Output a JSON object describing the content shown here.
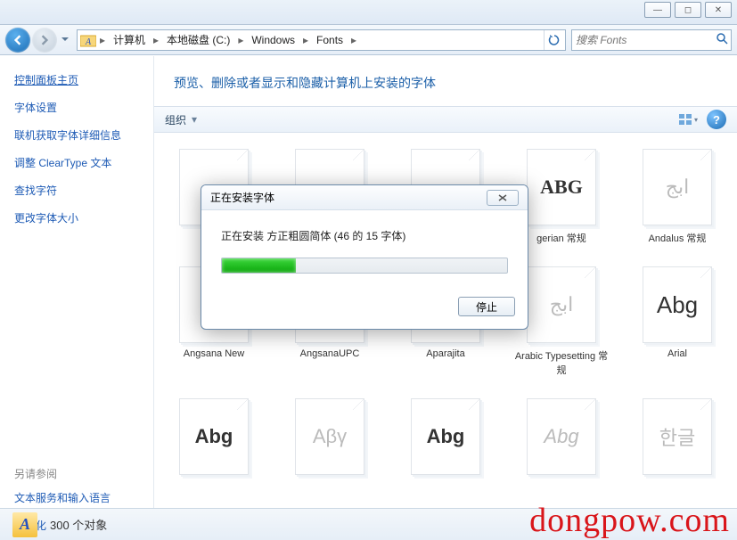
{
  "window": {
    "min": "—",
    "max": "◻",
    "close": "✕"
  },
  "breadcrumb": [
    "计算机",
    "本地磁盘 (C:)",
    "Windows",
    "Fonts"
  ],
  "search": {
    "placeholder": "搜索 Fonts"
  },
  "sidebar": {
    "heading": "控制面板主页",
    "links": [
      "字体设置",
      "联机获取字体详细信息",
      "调整 ClearType 文本",
      "查找字符",
      "更改字体大小"
    ],
    "also_label": "另请参阅",
    "also_links": [
      "文本服务和输入语言",
      "个性化"
    ]
  },
  "header": {
    "title": "预览、删除或者显示和隐藏计算机上安装的字体"
  },
  "toolbar": {
    "organize": "组织",
    "help": "?"
  },
  "fonts_row1": [
    {
      "sample": "",
      "label": ""
    },
    {
      "sample": "",
      "label": ""
    },
    {
      "sample": "",
      "label": ""
    },
    {
      "sample": "ABG",
      "label": "gerian 常规",
      "partial": true
    },
    {
      "sample": "ابج",
      "label": "Andalus 常规"
    }
  ],
  "fonts_row2": [
    {
      "sample": "",
      "label": "Angsana New"
    },
    {
      "sample": "",
      "label": "AngsanaUPC"
    },
    {
      "sample": "",
      "label": "Aparajita"
    },
    {
      "sample": "ابج",
      "label": "Arabic Typesetting 常规"
    },
    {
      "sample": "Abg",
      "label": "Arial"
    }
  ],
  "fonts_row3": [
    {
      "sample": "Abg",
      "label": ""
    },
    {
      "sample": "Αβγ",
      "label": "",
      "faded": true
    },
    {
      "sample": "Abg",
      "label": ""
    },
    {
      "sample": "Abg",
      "label": "",
      "faded": true
    },
    {
      "sample": "한글",
      "label": "",
      "faded": true
    }
  ],
  "status": {
    "text": "300 个对象",
    "icon_glyph": "A"
  },
  "dialog": {
    "title": "正在安装字体",
    "message": "正在安装 方正粗圆简体 (46 的 15 字体)",
    "stop": "停止",
    "progress_pct": 26
  },
  "watermark": "dongpow.com"
}
